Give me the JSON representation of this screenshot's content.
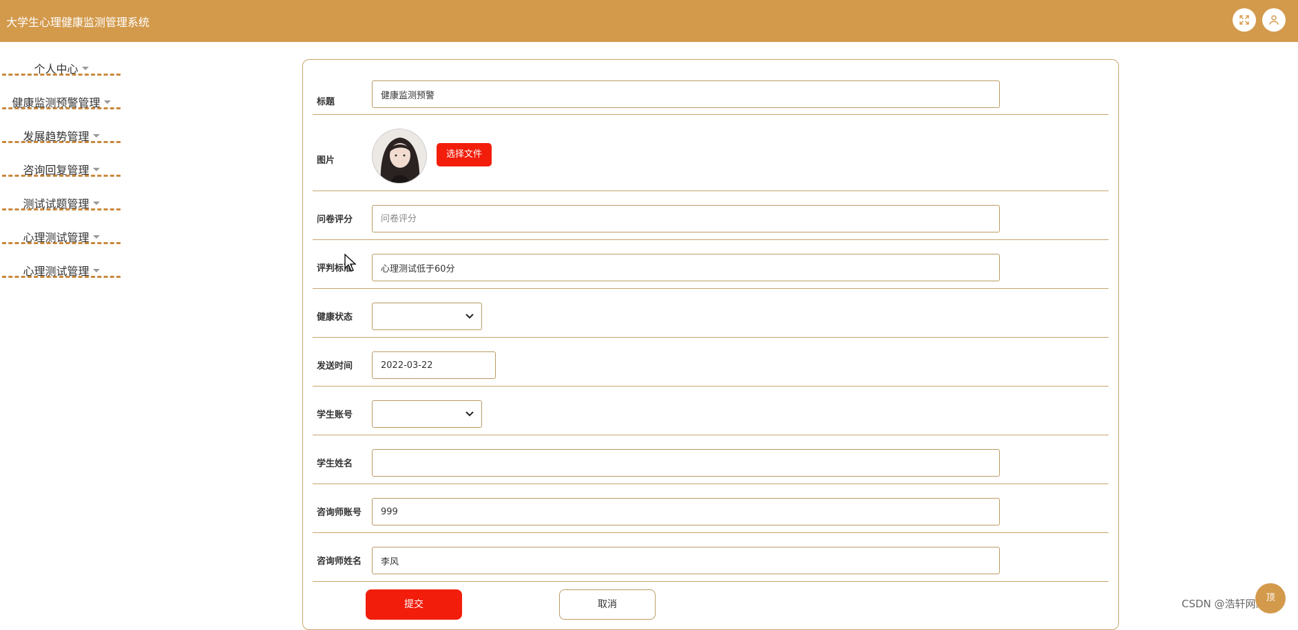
{
  "app": {
    "title": "大学生心理健康监测管理系统"
  },
  "header": {
    "fullscreen_icon": "fullscreen-icon",
    "user_icon": "user-icon"
  },
  "sidebar": {
    "items": [
      {
        "label": "个人中心"
      },
      {
        "label": "健康监测预警管理"
      },
      {
        "label": "发展趋势管理"
      },
      {
        "label": "咨询回复管理"
      },
      {
        "label": "测试试题管理"
      },
      {
        "label": "心理测试管理"
      },
      {
        "label": "心理测试管理"
      }
    ]
  },
  "form": {
    "title": {
      "label": "标题",
      "value": "健康监测预警"
    },
    "image": {
      "label": "图片",
      "button": "选择文件"
    },
    "score": {
      "label": "问卷评分",
      "placeholder": "问卷评分",
      "value": ""
    },
    "criteria": {
      "label": "评判标准",
      "value": "心理测试低于60分"
    },
    "health_status": {
      "label": "健康状态",
      "value": ""
    },
    "send_time": {
      "label": "发送时间",
      "value": "2022-03-22"
    },
    "student_account": {
      "label": "学生账号",
      "value": ""
    },
    "student_name": {
      "label": "学生姓名",
      "value": ""
    },
    "counselor_account": {
      "label": "咨询师账号",
      "value": "999"
    },
    "counselor_name": {
      "label": "咨询师姓名",
      "value": "李风"
    },
    "submit": "提交",
    "cancel": "取消"
  },
  "overlay": {
    "watermark": "CSDN @浩轩网络",
    "float_button": "顶"
  },
  "colors": {
    "header_bg": "#d39a4c",
    "primary_button": "#f21d0b",
    "sidebar_divider": "#c9883b",
    "border": "#b99a62"
  }
}
